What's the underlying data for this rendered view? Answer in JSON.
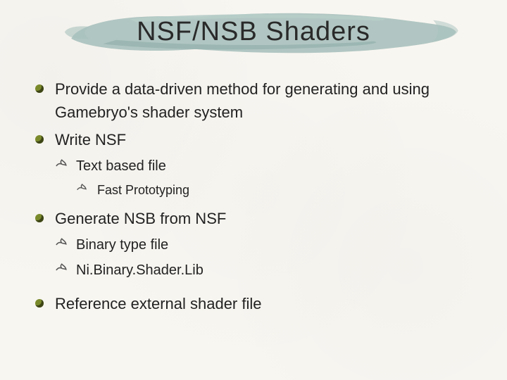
{
  "title": "NSF/NSB Shaders",
  "bullets": {
    "b1": "Provide a data-driven method for generating and using Gamebryo's shader system",
    "b2": "Write NSF",
    "b2_1": "Text based file",
    "b2_1_1": "Fast Prototyping",
    "b3": "Generate NSB from NSF",
    "b3_1": "Binary type file",
    "b3_2": "Ni.Binary.Shader.Lib",
    "b4": "Reference external shader file"
  },
  "colors": {
    "brush": "#a8c1bd",
    "bullet": "#7a8a2b",
    "background": "#f8f6f1"
  }
}
